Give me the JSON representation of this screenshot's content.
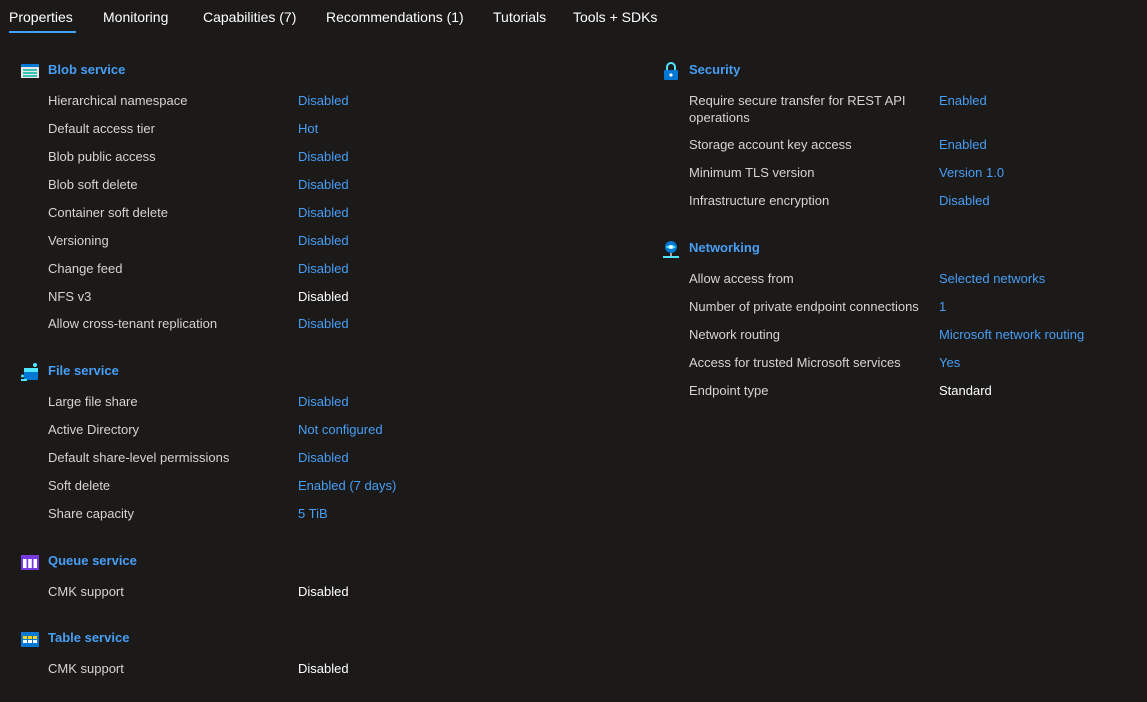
{
  "tabs": [
    "Properties",
    "Monitoring",
    "Capabilities (7)",
    "Recommendations (1)",
    "Tutorials",
    "Tools + SDKs"
  ],
  "blob": {
    "title": "Blob service",
    "rows": [
      {
        "label": "Hierarchical namespace",
        "value": "Disabled"
      },
      {
        "label": "Default access tier",
        "value": "Hot"
      },
      {
        "label": "Blob public access",
        "value": "Disabled"
      },
      {
        "label": "Blob soft delete",
        "value": "Disabled"
      },
      {
        "label": "Container soft delete",
        "value": "Disabled"
      },
      {
        "label": "Versioning",
        "value": "Disabled"
      },
      {
        "label": "Change feed",
        "value": "Disabled"
      },
      {
        "label": "NFS v3",
        "value": "Disabled"
      },
      {
        "label": "Allow cross-tenant replication",
        "value": "Disabled"
      }
    ]
  },
  "file": {
    "title": "File service",
    "rows": [
      {
        "label": "Large file share",
        "value": "Disabled"
      },
      {
        "label": "Active Directory",
        "value": "Not configured"
      },
      {
        "label": "Default share-level permissions",
        "value": "Disabled"
      },
      {
        "label": "Soft delete",
        "value": "Enabled (7 days)"
      },
      {
        "label": "Share capacity",
        "value": "5 TiB"
      }
    ]
  },
  "queue": {
    "title": "Queue service",
    "rows": [
      {
        "label": "CMK support",
        "value": "Disabled"
      }
    ]
  },
  "table": {
    "title": "Table service",
    "rows": [
      {
        "label": "CMK support",
        "value": "Disabled"
      }
    ]
  },
  "security": {
    "title": "Security",
    "rows": [
      {
        "label": "Require secure transfer for REST API",
        "label2": "operations",
        "value": "Enabled"
      },
      {
        "label": "Storage account key access",
        "value": "Enabled"
      },
      {
        "label": "Minimum TLS version",
        "value": "Version 1.0"
      },
      {
        "label": "Infrastructure encryption",
        "value": "Disabled"
      }
    ]
  },
  "networking": {
    "title": "Networking",
    "rows": [
      {
        "label": "Allow access from",
        "value": "Selected networks"
      },
      {
        "label": "Number of private endpoint connections",
        "value": "1"
      },
      {
        "label": "Network routing",
        "value": "Microsoft network routing"
      },
      {
        "label": "Access for trusted Microsoft services",
        "value": "Yes"
      },
      {
        "label": "Endpoint type",
        "value": "Standard"
      }
    ]
  },
  "colors": {
    "link": "#479ef5",
    "background": "#1b1a19",
    "text": "#d6d4d2"
  }
}
